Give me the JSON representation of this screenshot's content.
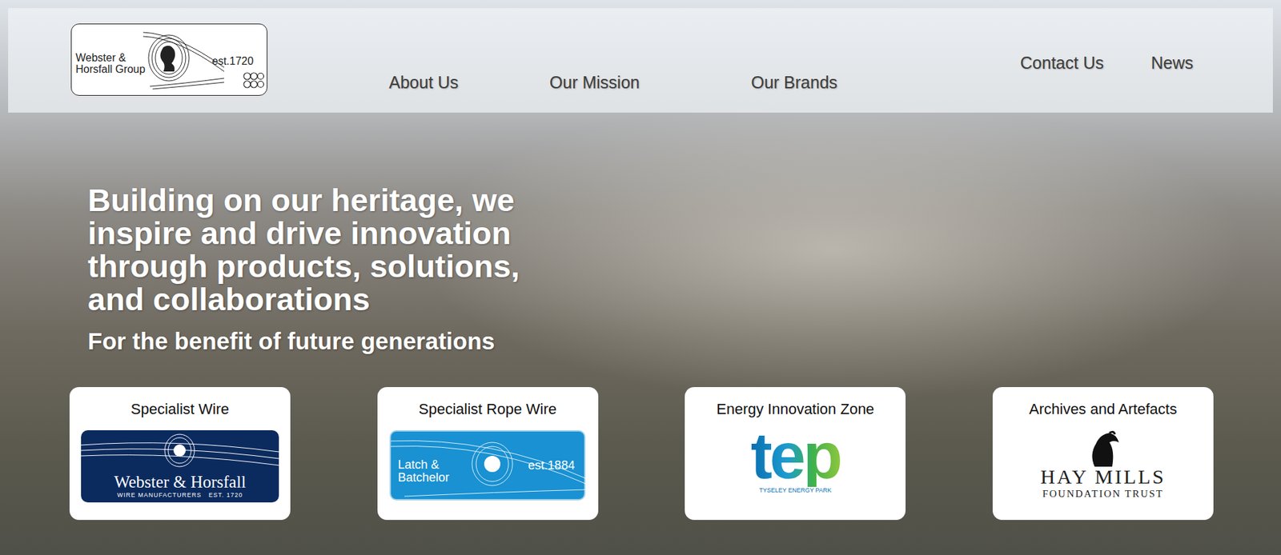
{
  "header": {
    "logo": {
      "line1": "Webster &",
      "line2": "Horsfall Group",
      "est": "est.1720"
    },
    "nav_left": [
      "About Us",
      "Our Mission",
      "Our Brands"
    ],
    "nav_right": [
      "Contact Us",
      "News"
    ]
  },
  "hero": {
    "headline": "Building on our heritage, we inspire and drive innovation through products, solutions, and collaborations",
    "subtitle": "For the benefit of future generations"
  },
  "cards": [
    {
      "title": "Specialist Wire",
      "kind": "navy",
      "logo": [
        "Webster & Horsfall",
        "WIRE MANUFACTURERS   EST. 1720"
      ]
    },
    {
      "title": "Specialist Rope Wire",
      "kind": "blue",
      "logo": [
        "Latch &",
        "Batchelor",
        "est.1884"
      ]
    },
    {
      "title": "Energy Innovation Zone",
      "kind": "tep",
      "logo": [
        "tep",
        "TYSELEY ENERGY PARK"
      ]
    },
    {
      "title": "Archives and Artefacts",
      "kind": "haymills",
      "logo": [
        "HAY MILLS",
        "FOUNDATION TRUST"
      ]
    }
  ]
}
